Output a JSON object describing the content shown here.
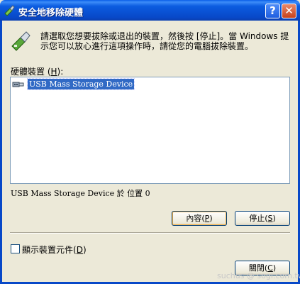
{
  "window": {
    "title": "安全地移除硬體",
    "help_button": "?",
    "close_button": "✕"
  },
  "instructions": "請選取您想要拔除或退出的裝置，然後按 [停止]。當 Windows 提示您可以放心進行這項操作時，請從您的電腦拔除裝置。",
  "hardware_list": {
    "label_prefix": "硬體裝置 (",
    "label_key": "H",
    "label_suffix": "):",
    "items": [
      {
        "label": "USB Mass Storage Device",
        "icon": "usb-device-icon",
        "selected": true
      }
    ]
  },
  "device_location": "USB Mass Storage Device 於 位置 0",
  "buttons": {
    "properties_prefix": "內容(",
    "properties_key": "P",
    "properties_suffix": ")",
    "stop_prefix": "停止(",
    "stop_key": "S",
    "stop_suffix": ")",
    "close_prefix": "關閉(",
    "close_key": "C",
    "close_suffix": ")"
  },
  "show_components": {
    "label_prefix": "顯示裝置元件(",
    "label_key": "D",
    "label_suffix": ")",
    "checked": false
  },
  "watermark": "suchus    @ sogi.com.tw",
  "colors": {
    "titlebar": "#0848c8",
    "selection": "#316ac5",
    "dialog_bg": "#ece9d8"
  }
}
